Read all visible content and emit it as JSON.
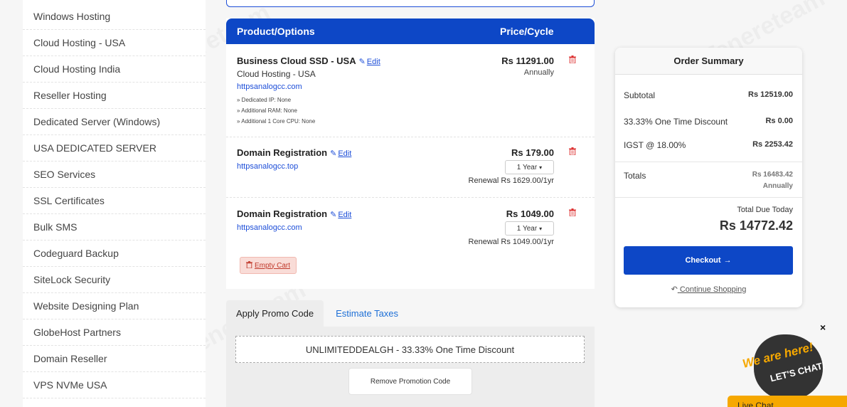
{
  "sidebar": {
    "items": [
      {
        "label": "Windows Hosting"
      },
      {
        "label": "Cloud Hosting - USA"
      },
      {
        "label": "Cloud Hosting India"
      },
      {
        "label": "Reseller Hosting"
      },
      {
        "label": "Dedicated Server (Windows)"
      },
      {
        "label": "USA DEDICATED SERVER"
      },
      {
        "label": "SEO Services"
      },
      {
        "label": "SSL Certificates"
      },
      {
        "label": "Bulk SMS"
      },
      {
        "label": "Codeguard Backup"
      },
      {
        "label": "SiteLock Security"
      },
      {
        "label": "Website Designing Plan"
      },
      {
        "label": "GlobeHost Partners"
      },
      {
        "label": "Domain Reseller"
      },
      {
        "label": "VPS NVMe USA"
      }
    ]
  },
  "cart": {
    "header_product": "Product/Options",
    "header_price": "Price/Cycle",
    "edit_label": "Edit",
    "items": [
      {
        "title": "Business Cloud SSD - USA",
        "group": "Cloud Hosting - USA",
        "domain": "httpsanalogcc.com",
        "options": [
          "» Dedicated IP: None",
          "» Additional RAM: None",
          "» Additional 1 Core CPU: None"
        ],
        "price": "Rs 11291.00",
        "cycle": "Annually"
      },
      {
        "title": "Domain Registration",
        "domain": "httpsanalogcc.top",
        "price": "Rs 179.00",
        "period": "1 Year",
        "renewal": "Renewal Rs 1629.00/1yr"
      },
      {
        "title": "Domain Registration",
        "domain": "httpsanalogcc.com",
        "price": "Rs 1049.00",
        "period": "1 Year",
        "renewal": "Renewal Rs 1049.00/1yr"
      }
    ],
    "empty_cart": "Empty Cart"
  },
  "promo": {
    "tab_promo": "Apply Promo Code",
    "tab_taxes": "Estimate Taxes",
    "applied_code": "UNLIMITEDDEALGH - 33.33% One Time Discount",
    "remove_label": "Remove Promotion Code"
  },
  "summary": {
    "title": "Order Summary",
    "subtotal_label": "Subtotal",
    "subtotal_value": "Rs 12519.00",
    "discount_label": "33.33% One Time Discount",
    "discount_value": "Rs 0.00",
    "tax_label": "IGST @ 18.00%",
    "tax_value": "Rs 2253.42",
    "totals_label": "Totals",
    "totals_value": "Rs 16483.42",
    "totals_cycle": "Annually",
    "due_label": "Total Due Today",
    "due_value": "Rs 14772.42",
    "checkout_label": "Checkout",
    "continue_label": "Continue Shopping"
  },
  "chat": {
    "close": "×",
    "line1": "We are here!",
    "line2": "LET'S CHAT!",
    "live_chat": "Live Chat"
  },
  "watermark": "Tenereteam",
  "colors": {
    "primary_blue": "#0d47c6",
    "link_blue": "#1d4ed8",
    "chat_yellow": "#f6a800",
    "danger_red": "#c0392b"
  }
}
